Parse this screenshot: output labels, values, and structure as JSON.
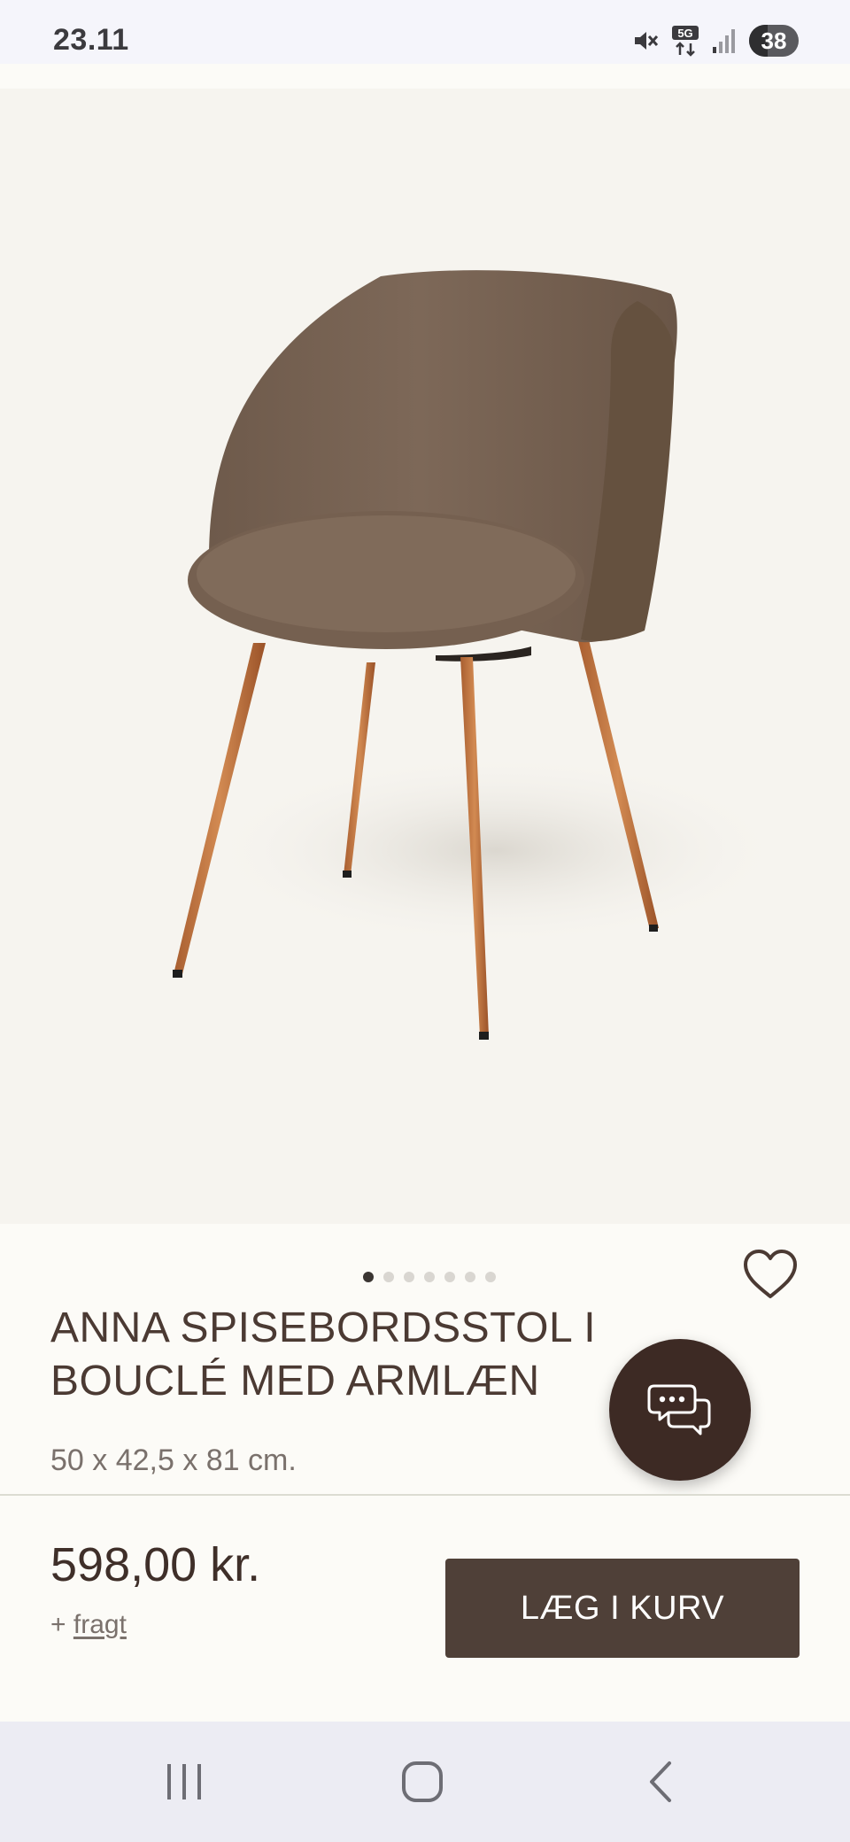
{
  "status_bar": {
    "time": "23.11",
    "network": "5G",
    "battery_level": "38",
    "battery_fraction": 0.38,
    "icons": [
      "mute-icon",
      "5g-data-icon",
      "signal-icon",
      "battery-icon"
    ]
  },
  "product": {
    "image_alt": "Brun bouclé spisebordsstol med armlæn og træben",
    "carousel": {
      "total": 7,
      "active_index": 0
    },
    "title": "ANNA SPISEBORDSSTOL I BOUCLÉ MED ARMLÆN",
    "dimensions": "50 x 42,5 x 81 cm.",
    "favorite_icon": "heart-outline-icon"
  },
  "chat": {
    "icon": "chat-bubbles-icon"
  },
  "buy_bar": {
    "price": "598,00 kr.",
    "shipping_prefix": "+",
    "shipping_link": "fragt",
    "add_to_cart_label": "LÆG I KURV"
  },
  "nav_bar": {
    "icons": [
      "recent-apps-icon",
      "home-icon",
      "back-icon"
    ]
  },
  "colors": {
    "accent_dark": "#3d2a24",
    "button": "#4f4038",
    "title_text": "#4b3a33",
    "background": "#fcfbf7"
  }
}
